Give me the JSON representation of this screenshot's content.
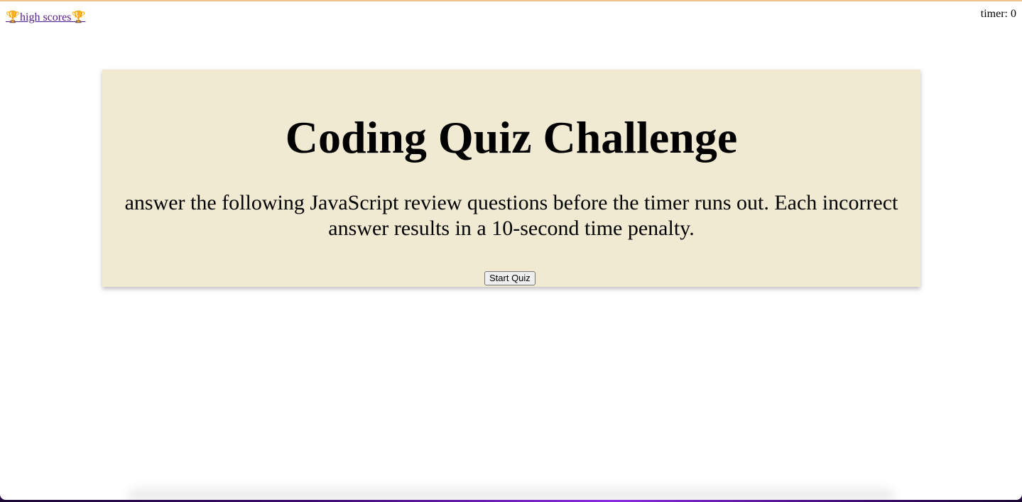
{
  "header": {
    "high_scores_label": "high scores",
    "trophy_glyph": "🏆",
    "timer_label": "timer:",
    "timer_value": "0"
  },
  "quiz": {
    "title": "Coding Quiz Challenge",
    "description": "answer the following JavaScript review questions before the timer runs out. Each incorrect answer results in a 10-second time penalty.",
    "start_button_label": "Start Quiz"
  },
  "colors": {
    "card_background": "#f0ead3",
    "link_color": "#551a8b",
    "top_border": "#f1c48f"
  }
}
